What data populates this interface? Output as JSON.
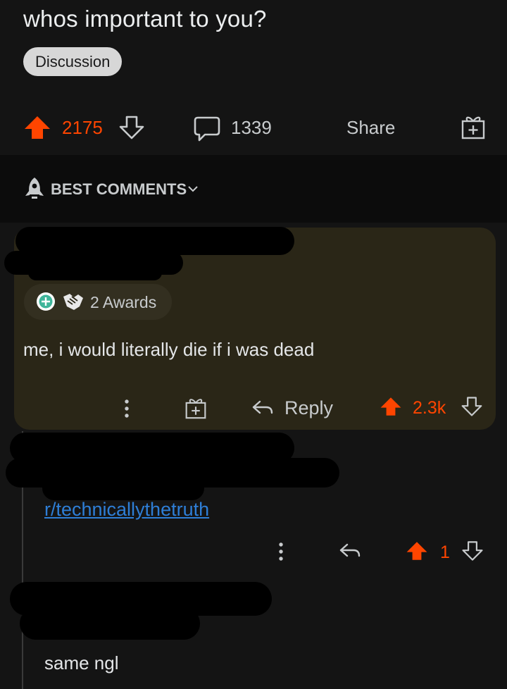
{
  "post": {
    "title": "whos important to you?",
    "flair": "Discussion",
    "score": "2175",
    "comment_count": "1339",
    "share_label": "Share"
  },
  "sort": {
    "label": "BEST COMMENTS"
  },
  "top_comment": {
    "awards_label": "2 Awards",
    "body": "me, i would literally die if i was dead",
    "reply_label": "Reply",
    "score": "2.3k"
  },
  "reply_comment": {
    "link_text": "r/technicallythetruth",
    "score": "1"
  },
  "third_comment": {
    "body": "same ngl"
  },
  "icons": {
    "upvote": "upvote-arrow-icon",
    "downvote": "downvote-arrow-icon",
    "comment": "comment-bubble-icon",
    "award": "gift-award-icon",
    "sort": "rocket-icon",
    "reply": "reply-arrow-icon",
    "more": "vertical-dots-icon"
  },
  "colors": {
    "background": "#141414",
    "upvote": "#ff4500",
    "link": "#2e7ed6",
    "highlight_card": "#2a2617"
  }
}
